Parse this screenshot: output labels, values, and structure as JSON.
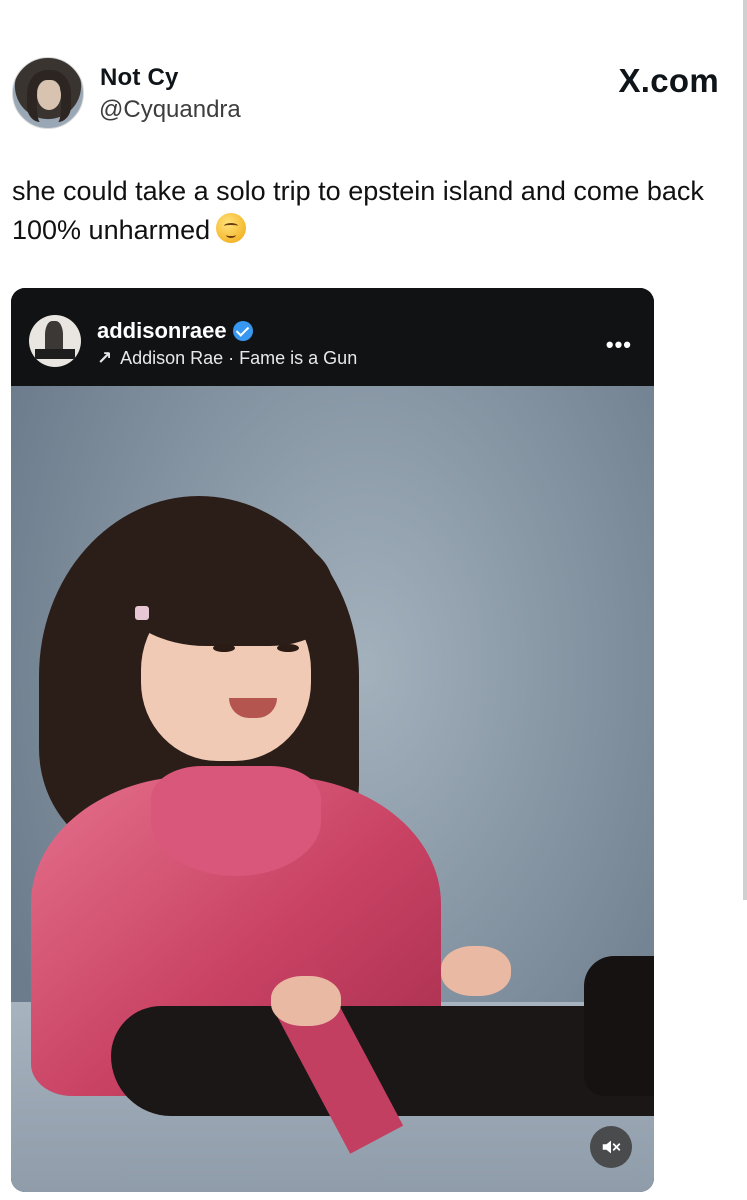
{
  "post": {
    "display_name": "Not Cy",
    "handle": "@Cyquandra",
    "site_label": "X.com",
    "text": "she could take a solo trip to epstein island and come back 100% unharmed",
    "emoji_icon": "woozy-face-emoji"
  },
  "embed": {
    "username": "addisonraee",
    "verified": true,
    "arrow_icon": "↗",
    "subline": "Addison Rae · Fame is a Gun",
    "more_icon": "•••",
    "mute_icon": "speaker-muted-icon"
  }
}
